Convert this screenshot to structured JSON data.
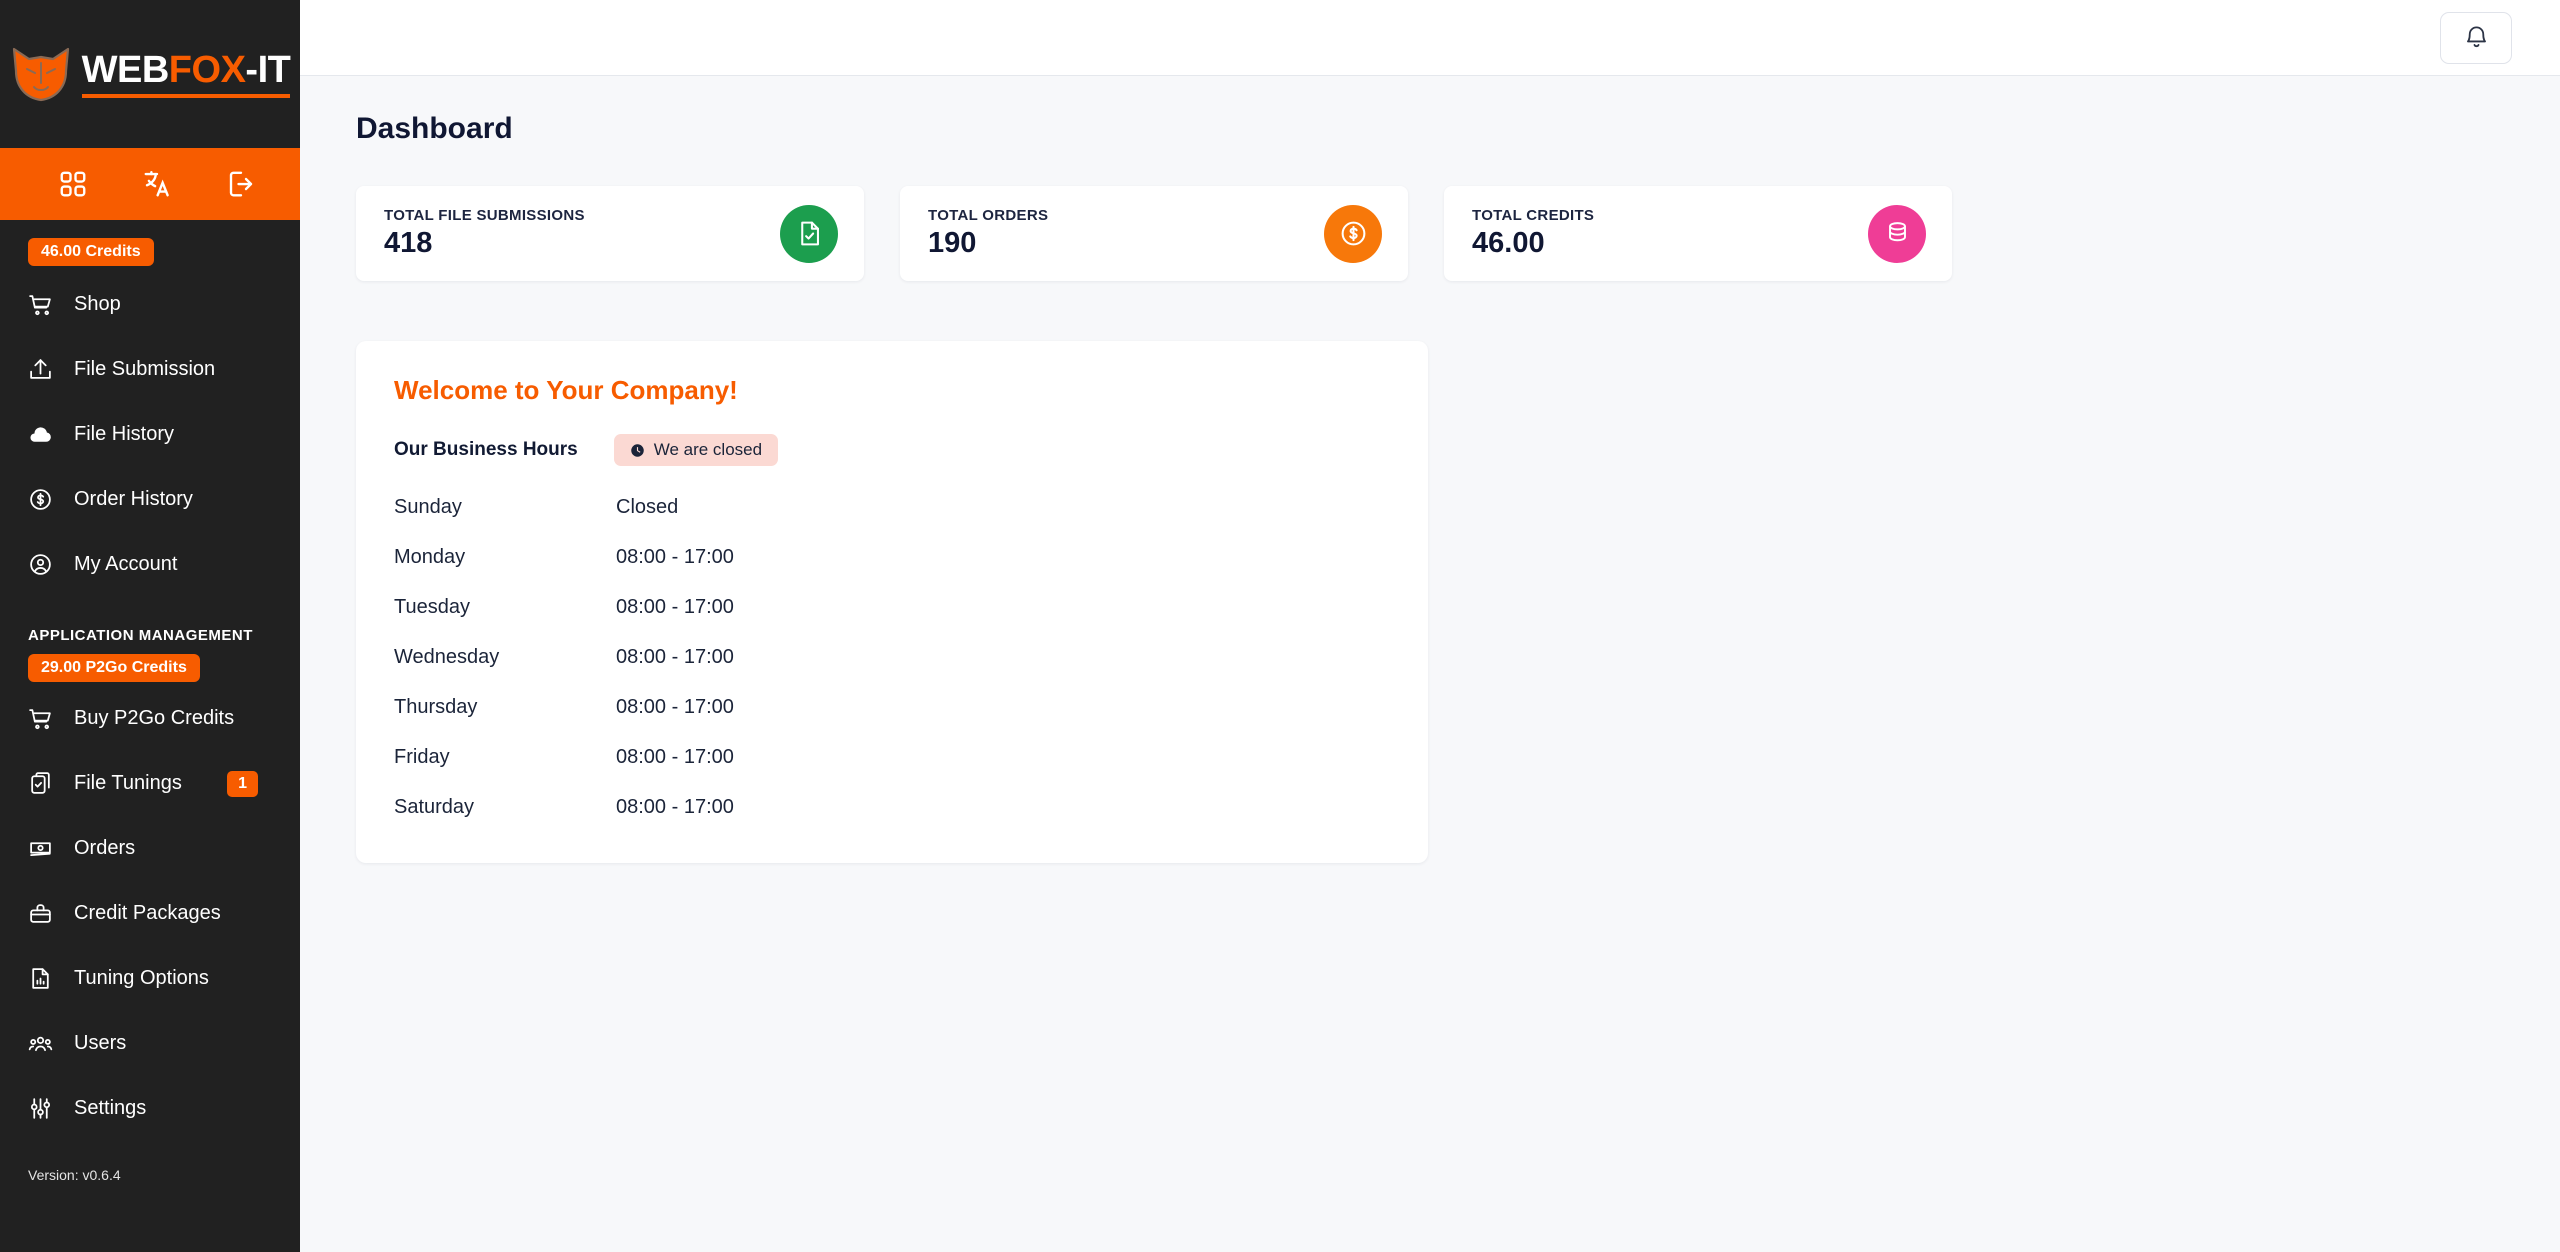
{
  "sidebar": {
    "logo": {
      "part1": "WEB",
      "part2": "FOX",
      "part3": "-IT",
      "icon": "fox-head-icon"
    },
    "icon_bar": [
      {
        "name": "apps-grid-icon",
        "label": "Apps"
      },
      {
        "name": "translate-icon",
        "label": "Language"
      },
      {
        "name": "logout-icon",
        "label": "Logout"
      }
    ],
    "credits_badge": "46.00 Credits",
    "nav_items": [
      {
        "label": "Shop",
        "icon": "shopping-cart-icon"
      },
      {
        "label": "File Submission",
        "icon": "upload-icon"
      },
      {
        "label": "File History",
        "icon": "cloud-icon"
      },
      {
        "label": "Order History",
        "icon": "dollar-circle-icon"
      },
      {
        "label": "My Account",
        "icon": "user-circle-icon"
      }
    ],
    "section_title": "APPLICATION MANAGEMENT",
    "p2go_badge": "29.00 P2Go Credits",
    "admin_items": [
      {
        "label": "Buy P2Go Credits",
        "icon": "shopping-cart-icon",
        "badge": ""
      },
      {
        "label": "File Tunings",
        "icon": "clipboard-check-icon",
        "badge": "1"
      },
      {
        "label": "Orders",
        "icon": "banknote-icon",
        "badge": ""
      },
      {
        "label": "Credit Packages",
        "icon": "briefcase-icon",
        "badge": ""
      },
      {
        "label": "Tuning Options",
        "icon": "file-chart-icon",
        "badge": ""
      },
      {
        "label": "Users",
        "icon": "users-group-icon",
        "badge": ""
      },
      {
        "label": "Settings",
        "icon": "sliders-icon",
        "badge": ""
      }
    ],
    "version": "Version: v0.6.4"
  },
  "topbar": {
    "notification_icon": "bell-icon"
  },
  "main": {
    "page_title": "Dashboard",
    "stats": [
      {
        "label": "TOTAL FILE SUBMISSIONS",
        "value": "418",
        "icon": "document-check-icon",
        "color": "#1c9e4e"
      },
      {
        "label": "TOTAL ORDERS",
        "value": "190",
        "icon": "dollar-circle-icon",
        "color": "#f7780a"
      },
      {
        "label": "TOTAL CREDITS",
        "value": "46.00",
        "icon": "coins-stack-icon",
        "color": "#ef3d96"
      }
    ],
    "welcome": {
      "title": "Welcome to Your Company!",
      "hours_label": "Our Business Hours",
      "status_badge": "We are closed",
      "status_icon": "clock-icon",
      "hours": [
        {
          "day": "Sunday",
          "time": "Closed"
        },
        {
          "day": "Monday",
          "time": "08:00 - 17:00"
        },
        {
          "day": "Tuesday",
          "time": "08:00 - 17:00"
        },
        {
          "day": "Wednesday",
          "time": "08:00 - 17:00"
        },
        {
          "day": "Thursday",
          "time": "08:00 - 17:00"
        },
        {
          "day": "Friday",
          "time": "08:00 - 17:00"
        },
        {
          "day": "Saturday",
          "time": "08:00 - 17:00"
        }
      ]
    }
  },
  "colors": {
    "brand_orange": "#f75c00",
    "sidebar_bg": "#212121",
    "page_bg": "#f7f8fa",
    "badge_closed_bg": "#fbd9d3"
  }
}
